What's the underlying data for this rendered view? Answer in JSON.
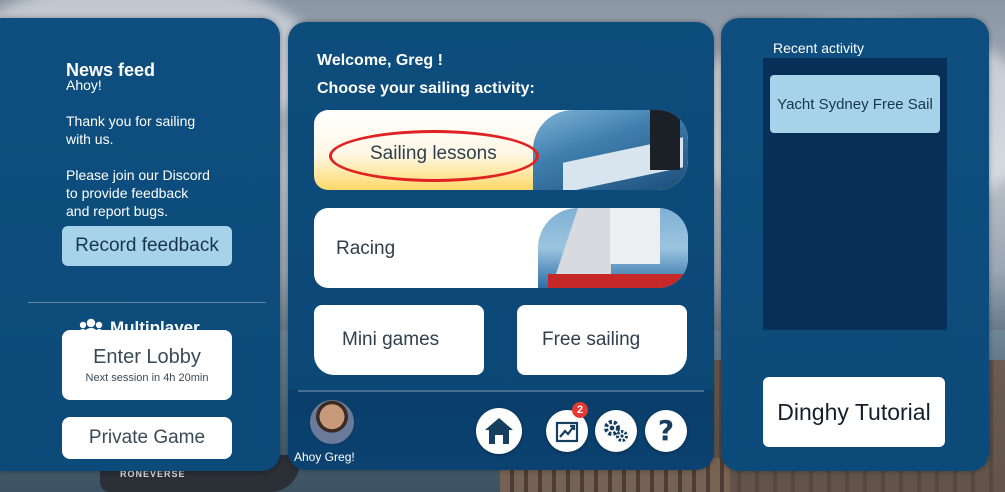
{
  "news": {
    "title": "News feed",
    "greeting": "Ahoy!",
    "thanks": "Thank you for sailing\nwith us.",
    "discord": "Please join our Discord\nto provide feedback\nand report bugs.",
    "record_feedback_label": "Record feedback"
  },
  "multiplayer": {
    "title": "Multiplayer",
    "enter_lobby_label": "Enter Lobby",
    "next_session": "Next session in 4h 20min",
    "private_game_label": "Private Game"
  },
  "center": {
    "welcome": "Welcome, Greg !",
    "choose": "Choose your sailing activity:",
    "activities": {
      "lessons": "Sailing lessons",
      "racing": "Racing",
      "mini_games": "Mini games",
      "free_sailing": "Free sailing"
    }
  },
  "bottom_bar": {
    "greeting": "Ahoy Greg!",
    "stats_badge": "2",
    "help_glyph": "?"
  },
  "recent": {
    "title": "Recent activity",
    "items": [
      "Yacht Sydney Free Sail"
    ],
    "dinghy_tutorial_label": "Dinghy Tutorial"
  },
  "colors": {
    "panel": "#0d4f7e",
    "light_button": "#a6d3ea",
    "badge": "#e53935",
    "highlight_oval": "#e02222"
  },
  "icons": [
    "users-icon",
    "home-icon",
    "stats-chart-icon",
    "settings-gears-icon",
    "help-icon",
    "avatar"
  ]
}
